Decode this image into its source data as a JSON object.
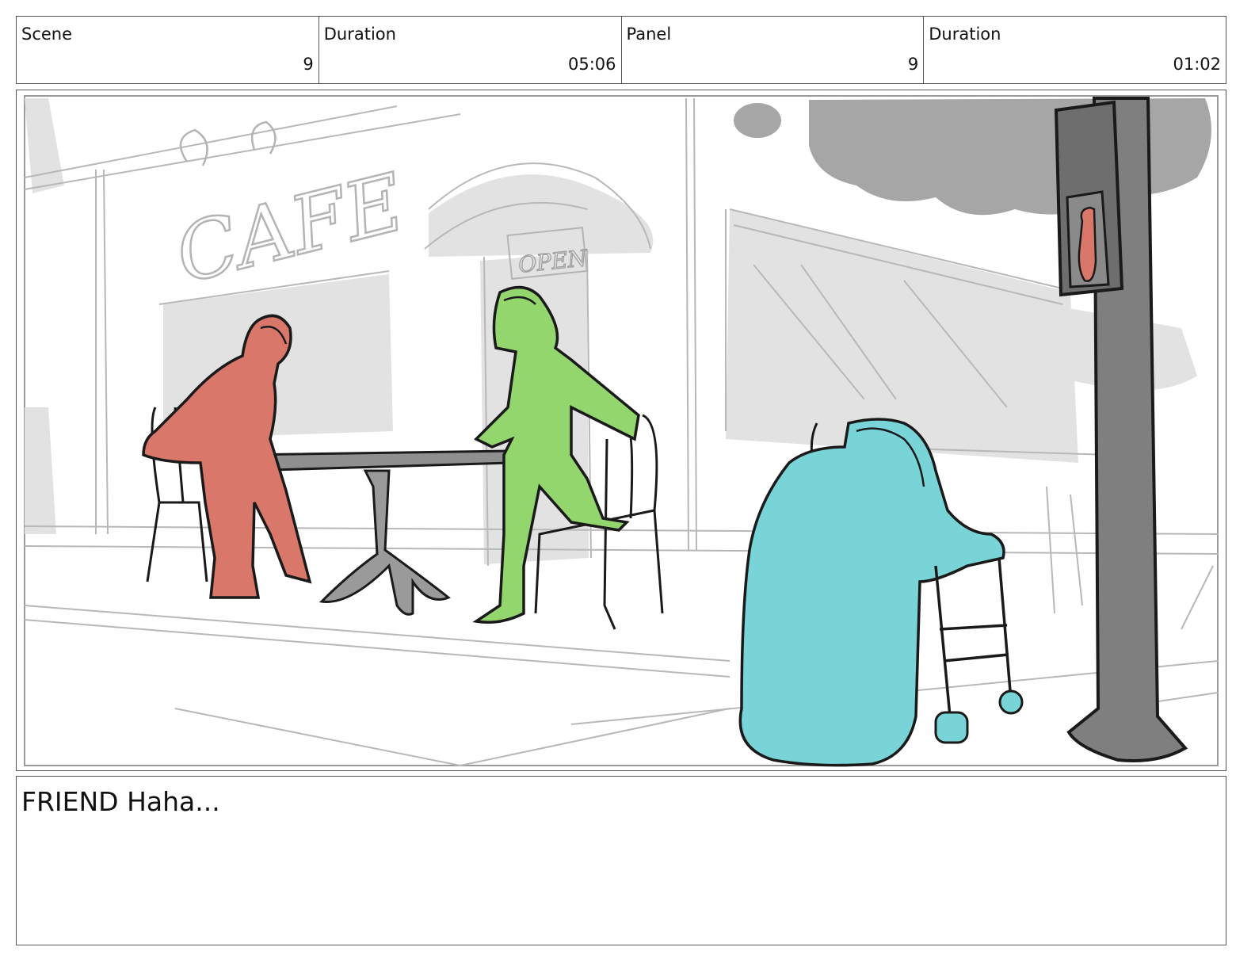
{
  "header": {
    "scene_label": "Scene",
    "scene_value": "9",
    "scene_duration_label": "Duration",
    "scene_duration_value": "05:06",
    "panel_label": "Panel",
    "panel_value": "9",
    "panel_duration_label": "Duration",
    "panel_duration_value": "01:02"
  },
  "illustration": {
    "sign_text": "CAFE",
    "door_text": "OPEN",
    "colors": {
      "red_character": "#d9776b",
      "green_character": "#93d66e",
      "cyan_character": "#79d4d8",
      "pole": "#7f7f7f",
      "background_gray": "#e2e2e2",
      "sketch_line": "#b4b4b4",
      "ink": "#1a1a1a"
    }
  },
  "caption": {
    "text": "FRIEND Haha..."
  }
}
